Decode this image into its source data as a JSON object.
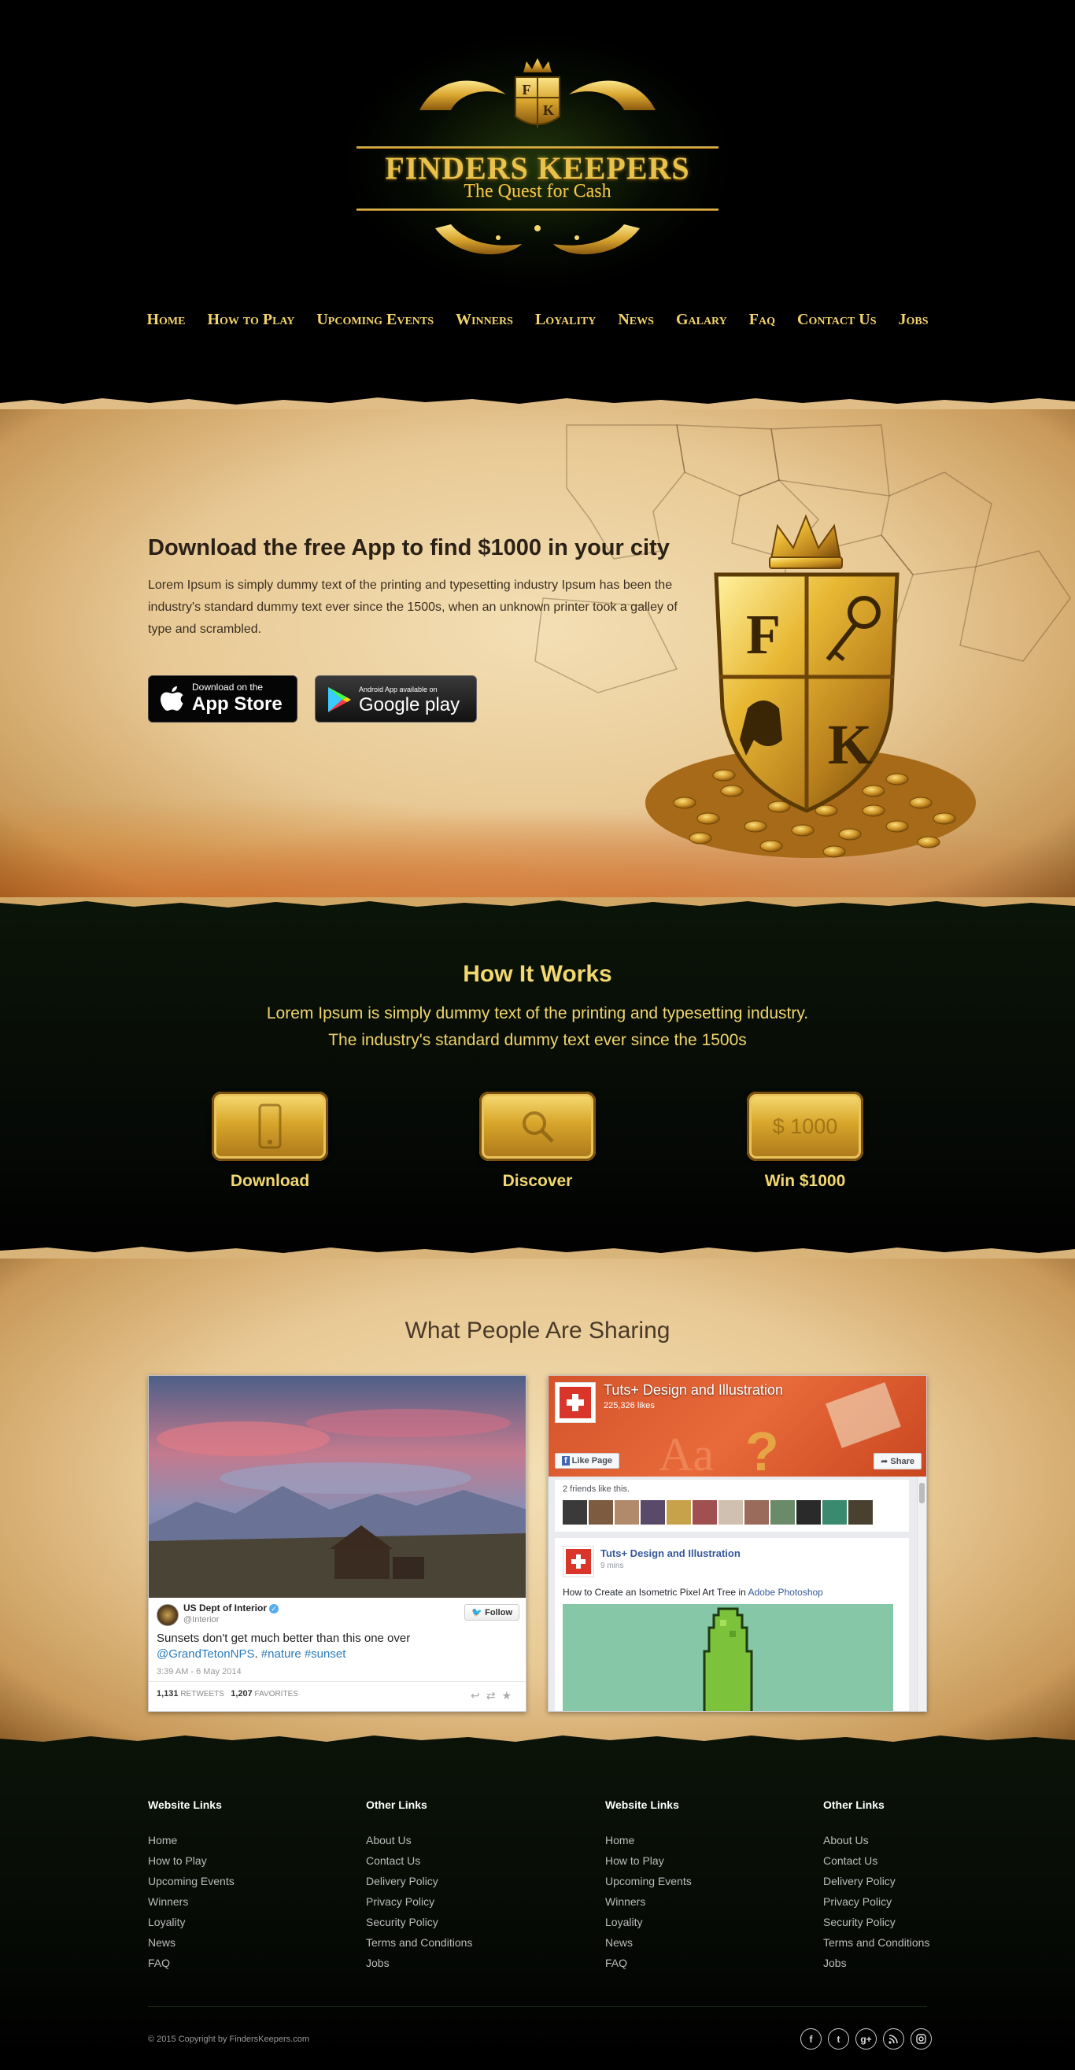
{
  "brand": {
    "monogram_left": "F",
    "monogram_right": "K",
    "title": "FINDERS KEEPERS",
    "tagline": "The Quest for Cash"
  },
  "nav": {
    "items": [
      "Home",
      "How to Play",
      "Upcoming Events",
      "Winners",
      "Loyality",
      "News",
      "Galary",
      "Faq",
      "Contact Us",
      "Jobs"
    ]
  },
  "hero": {
    "title_before": "Download the free App to find ",
    "title_amount": "$1000",
    "title_after": " in your city",
    "text": "Lorem Ipsum is simply dummy text of the printing and typesetting industry Ipsum has been the industry's standard dummy text ever since the 1500s, when an unknown printer took a galley of type and scrambled.",
    "apple": {
      "small": "Download on the",
      "big": "App Store"
    },
    "google": {
      "small": "Android App available on",
      "big": "Google play"
    },
    "shield_letters": [
      "F",
      "K"
    ]
  },
  "how": {
    "title": "How It Works",
    "subtitle_1": "Lorem Ipsum is simply dummy text of the printing and typesetting industry.",
    "subtitle_2": "The industry's standard dummy text ever since the 1500s",
    "steps": [
      {
        "label": "Download",
        "icon": "phone-icon",
        "plate_text": ""
      },
      {
        "label": "Discover",
        "icon": "magnifier-icon",
        "plate_text": ""
      },
      {
        "label": "Win $1000",
        "icon": "money-icon",
        "plate_text": "$ 1000"
      }
    ]
  },
  "sharing": {
    "title": "What People Are Sharing",
    "tweet": {
      "name": "US Dept of Interior",
      "handle": "@Interior",
      "follow": "Follow",
      "text": "Sunsets don't get much better than this one over",
      "link_1": "@GrandTetonNPS",
      "link_2": "#nature",
      "link_3": "#sunset",
      "time": "3:39 AM - 6 May 2014",
      "retweets": "1,131",
      "retweets_label": "RETWEETS",
      "favorites": "1,207",
      "favorites_label": "FAVORITES"
    },
    "facebook": {
      "page_name": "Tuts+ Design and Illustration",
      "likes": "225,326 likes",
      "like_button": "Like Page",
      "share_button": "Share",
      "friends": "2 friends like this.",
      "post_author": "Tuts+ Design and Illustration",
      "post_time": "9 mins",
      "post_text": "How to Create an Isometric Pixel Art Tree in ",
      "post_link": "Adobe Photoshop"
    }
  },
  "footer": {
    "columns": [
      {
        "title": "Website Links",
        "links": [
          "Home",
          "How to Play",
          "Upcoming Events",
          "Winners",
          "Loyality",
          "News",
          "FAQ"
        ]
      },
      {
        "title": "Other Links",
        "links": [
          "About Us",
          "Contact Us",
          "Delivery Policy",
          "Privacy Policy",
          "Security Policy",
          "Terms and Conditions",
          "Jobs"
        ]
      },
      {
        "title": "Website Links",
        "links": [
          "Home",
          "How to Play",
          "Upcoming Events",
          "Winners",
          "Loyality",
          "News",
          "FAQ"
        ]
      },
      {
        "title": "Other Links",
        "links": [
          "About Us",
          "Contact Us",
          "Delivery Policy",
          "Privacy Policy",
          "Security Policy",
          "Terms and Conditions",
          "Jobs"
        ]
      }
    ],
    "copyright": "© 2015 Copyright by FindersKeepers.com",
    "socials": [
      "facebook-icon",
      "twitter-icon",
      "google-plus-icon",
      "rss-icon",
      "instagram-icon"
    ]
  },
  "colors": {
    "gold": "#f2d86f",
    "nav_gold": "#f3d36b",
    "parchment": "#e8c995",
    "dark_green": "#0b1408"
  }
}
